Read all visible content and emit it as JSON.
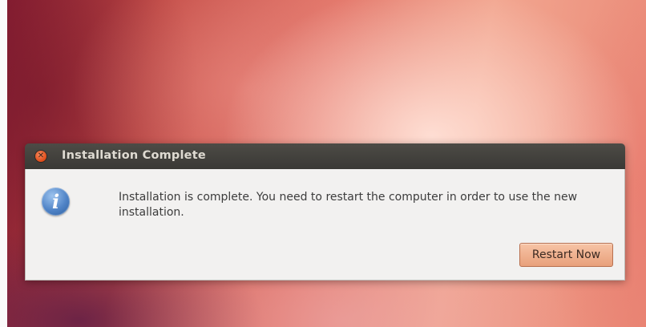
{
  "dialog": {
    "title": "Installation Complete",
    "close_icon": "close-icon",
    "info_icon": "info-icon",
    "info_glyph": "i",
    "message": "Installation is complete. You need to restart the computer in order to use the new installation.",
    "restart_label": "Restart Now"
  },
  "colors": {
    "titlebar": "#3d3c38",
    "dialog_body": "#f2f1f0",
    "close_button": "#df4b18",
    "button_accent": "#eda985",
    "info_icon": "#4f83c6"
  }
}
